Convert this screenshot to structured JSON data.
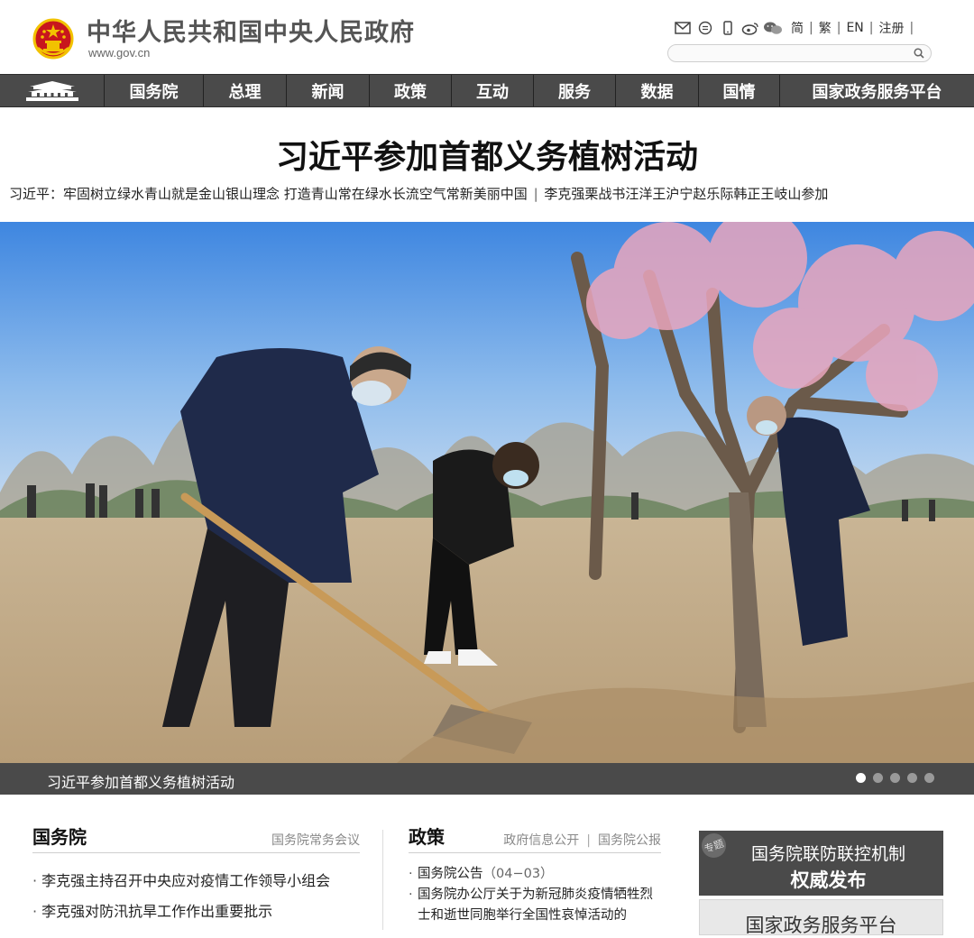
{
  "header": {
    "site_title": "中华人民共和国中央人民政府",
    "site_domain": "www.gov.cn",
    "toolbar": {
      "icons": [
        "mail-icon",
        "message-icon",
        "mobile-icon",
        "weibo-icon",
        "wechat-icon"
      ],
      "lang_simplified": "简",
      "lang_traditional": "繁",
      "lang_english": "EN",
      "register": "注册",
      "separator": "|"
    },
    "search": {
      "placeholder": ""
    }
  },
  "nav": {
    "home_icon": "tiananmen-icon",
    "items": [
      "国务院",
      "总理",
      "新闻",
      "政策",
      "互动",
      "服务",
      "数据",
      "国情",
      "国家政务服务平台"
    ]
  },
  "headline": {
    "title": "习近平参加首都义务植树活动",
    "sub_links": [
      "习近平：牢固树立绿水青山就是金山银山理念 打造青山常在绿水长流空气常新美丽中国",
      "|",
      "李克强栗战书汪洋王沪宁赵乐际韩正王岐山参加"
    ]
  },
  "slider": {
    "caption": "习近平参加首都义务植树活动",
    "dot_count": 5,
    "active_dot": 1
  },
  "state_council": {
    "title": "国务院",
    "more_link": "国务院常务会议",
    "items": [
      "李克强主持召开中央应对疫情工作领导小组会",
      "李克强对防汛抗旱工作作出重要批示"
    ]
  },
  "policy": {
    "title": "政策",
    "links": [
      "政府信息公开",
      "国务院公报"
    ],
    "items": [
      {
        "text": "国务院公告",
        "date": "（04−03）"
      },
      {
        "text": "国务院办公厅关于为新冠肺炎疫情牺牲烈士和逝世同胞举行全国性哀悼活动的",
        "date": ""
      }
    ]
  },
  "sidebar": {
    "promo_tag": "专题",
    "promo_line1": "国务院联防联控机制",
    "promo_line2": "权威发布",
    "service_label": "国家政务服务平台"
  },
  "colors": {
    "nav_bg": "#4a4a4a",
    "title_gray": "#555555",
    "emblem_red": "#c8161d",
    "emblem_gold": "#f2c200"
  }
}
